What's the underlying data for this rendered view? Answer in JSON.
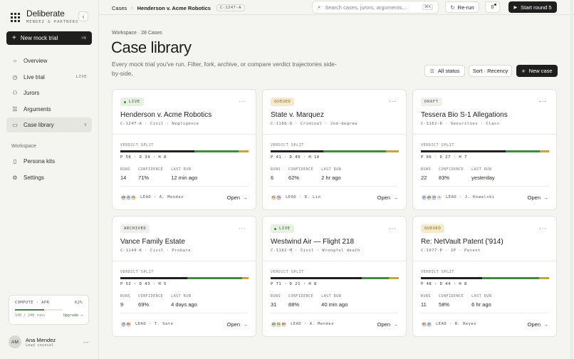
{
  "brand": {
    "name": "Deliberate",
    "sub": "MENDEZ & PARTNERS"
  },
  "sidebar": {
    "new_trial": "New mock trial",
    "new_trial_kbd": "⌘N",
    "items": [
      {
        "label": "Overview",
        "icon": "○",
        "tag": ""
      },
      {
        "label": "Live trial",
        "icon": "◷",
        "tag": "LIVE"
      },
      {
        "label": "Jurors",
        "icon": "⚇",
        "tag": ""
      },
      {
        "label": "Arguments",
        "icon": "☰",
        "tag": ""
      },
      {
        "label": "Case library",
        "icon": "▭",
        "tag": "6"
      }
    ],
    "workspace_label": "Workspace",
    "workspace_items": [
      {
        "label": "Persona kits",
        "icon": "▯"
      },
      {
        "label": "Settings",
        "icon": "⚙"
      }
    ],
    "compute": {
      "label": "COMPUTE · APR",
      "percent": "62%",
      "fraction": 0.62,
      "runs": "148 / 240 runs",
      "upgrade": "Upgrade →"
    },
    "user": {
      "initials": "AM",
      "name": "Ana Mendez",
      "role": "Lead counsel"
    }
  },
  "topbar": {
    "crumb1": "Cases",
    "crumb2": "Henderson v. Acme Robotics",
    "crumb_id": "C-1247-A",
    "search_placeholder": "Search cases, jurors, arguments…",
    "search_kbd": "⌘K",
    "rerun": "Re-run",
    "notif_count": "0",
    "start_round": "Start round 5"
  },
  "main": {
    "eyebrow": "Workspace · 28 Cases",
    "title": "Case library",
    "description": "Every mock trial you've run. Filter, fork, archive, or compare verdict trajectories side-by-side.",
    "all_status": "All status",
    "sort": "Sort · Recency",
    "new_case": "New case"
  },
  "card_labels": {
    "split": "VERDICT SPLIT",
    "runs": "RUNS",
    "confidence": "CONFIDENCE",
    "last_run": "LAST RUN",
    "open": "Open",
    "lead": "LEAD"
  },
  "cards": [
    {
      "status": "LIVE",
      "status_class": "st-live",
      "title": "Henderson v. Acme Robotics",
      "meta": "C-1247-A · Civil · Negligence",
      "p": 58,
      "d": 34,
      "h": 8,
      "vals": "P 58 · D 34 · H 8",
      "runs": "14",
      "confidence": "71%",
      "last_run": "12 min ago",
      "avatars": [
        {
          "i": "AM",
          "c": "#c9dbc2"
        },
        {
          "i": "JK",
          "c": "#c8d2e0"
        },
        {
          "i": "RL",
          "c": "#e6d7b0"
        }
      ],
      "lead": "A. Mendez"
    },
    {
      "status": "QUEUED",
      "status_class": "st-queued",
      "title": "State v. Marquez",
      "meta": "C-1188-Q · Criminal · 2nd-degree",
      "p": 41,
      "d": 49,
      "h": 10,
      "vals": "P 41 · D 49 · H 10",
      "runs": "6",
      "confidence": "62%",
      "last_run": "2 hr ago",
      "avatars": [
        {
          "i": "RL",
          "c": "#e6d7b0"
        },
        {
          "i": "TS",
          "c": "#d9c6e0"
        }
      ],
      "lead": "R. Lin"
    },
    {
      "status": "DRAFT",
      "status_class": "st-draft",
      "title": "Tessera Bio S-1 Allegations",
      "meta": "C-1162-D · Securities · Class",
      "p": 66,
      "d": 27,
      "h": 7,
      "vals": "P 66 · D 27 · H 7",
      "runs": "22",
      "confidence": "83%",
      "last_run": "yesterday",
      "avatars": [
        {
          "i": "JK",
          "c": "#c8d2e0"
        },
        {
          "i": "AM",
          "c": "#c9dbc2"
        },
        {
          "i": "TS",
          "c": "#d9c6e0"
        },
        {
          "i": "+2",
          "c": "#ececea"
        }
      ],
      "lead": "J. Kowalski"
    },
    {
      "status": "ARCHIVED",
      "status_class": "st-archived",
      "title": "Vance Family Estate",
      "meta": "C-1144-K · Civil · Probate",
      "p": 52,
      "d": 43,
      "h": 5,
      "vals": "P 52 · D 43 · H 5",
      "runs": "9",
      "confidence": "69%",
      "last_run": "4 days ago",
      "avatars": [
        {
          "i": "TS",
          "c": "#d9c6e0"
        },
        {
          "i": "BR",
          "c": "#f0d2c4"
        }
      ],
      "lead": "T. Sato"
    },
    {
      "status": "LIVE",
      "status_class": "st-live",
      "title": "Westwind Air — Flight 218",
      "meta": "C-1182-M · Civil · Wrongful death",
      "p": 71,
      "d": 21,
      "h": 8,
      "vals": "P 71 · D 21 · H 8",
      "runs": "31",
      "confidence": "88%",
      "last_run": "40 min ago",
      "avatars": [
        {
          "i": "AM",
          "c": "#c9dbc2"
        },
        {
          "i": "RL",
          "c": "#e6d7b0"
        },
        {
          "i": "BR",
          "c": "#f0d2c4"
        }
      ],
      "lead": "A. Mendez"
    },
    {
      "status": "QUEUED",
      "status_class": "st-queued",
      "title": "Re: NetVault Patent ('914)",
      "meta": "C-1077-P · IP · Patent",
      "p": 48,
      "d": 44,
      "h": 8,
      "vals": "P 48 · D 44 · H 8",
      "runs": "11",
      "confidence": "58%",
      "last_run": "6 hr ago",
      "avatars": [
        {
          "i": "BR",
          "c": "#f0d2c4"
        },
        {
          "i": "JK",
          "c": "#c8d2e0"
        }
      ],
      "lead": "B. Reyes"
    }
  ]
}
